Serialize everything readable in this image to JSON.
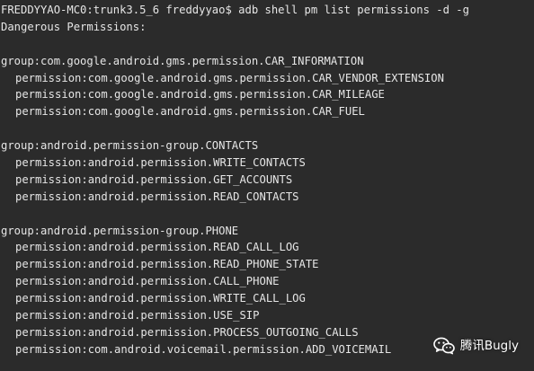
{
  "terminal": {
    "prompt": "FREDDYYAO-MC0:trunk3.5_6 freddyyao$",
    "command": "adb shell pm list permissions -d -g",
    "heading": "Dangerous Permissions:",
    "groups": [
      {
        "group": "group:com.google.android.gms.permission.CAR_INFORMATION",
        "permissions": [
          "permission:com.google.android.gms.permission.CAR_VENDOR_EXTENSION",
          "permission:com.google.android.gms.permission.CAR_MILEAGE",
          "permission:com.google.android.gms.permission.CAR_FUEL"
        ]
      },
      {
        "group": "group:android.permission-group.CONTACTS",
        "permissions": [
          "permission:android.permission.WRITE_CONTACTS",
          "permission:android.permission.GET_ACCOUNTS",
          "permission:android.permission.READ_CONTACTS"
        ]
      },
      {
        "group": "group:android.permission-group.PHONE",
        "permissions": [
          "permission:android.permission.READ_CALL_LOG",
          "permission:android.permission.READ_PHONE_STATE",
          "permission:android.permission.CALL_PHONE",
          "permission:android.permission.WRITE_CALL_LOG",
          "permission:android.permission.USE_SIP",
          "permission:android.permission.PROCESS_OUTGOING_CALLS",
          "permission:com.android.voicemail.permission.ADD_VOICEMAIL"
        ]
      }
    ]
  },
  "watermark": {
    "icon": "wechat-icon",
    "label": "腾讯Bugly"
  },
  "colors": {
    "background": "#2b2b2b",
    "text": "#e6e6e6"
  }
}
